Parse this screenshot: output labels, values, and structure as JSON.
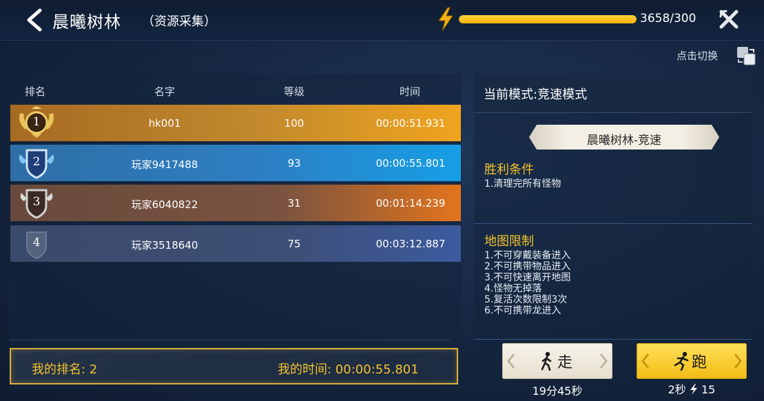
{
  "header": {
    "title": "晨曦树林",
    "subtitle": "（资源采集）",
    "energy_value": 3658,
    "energy_max": 300,
    "energy_text": "3658/300",
    "energy_fill_fraction": 1.0
  },
  "switch_label": "点击切换",
  "ranking": {
    "columns": [
      "排名",
      "名字",
      "等级",
      "时间"
    ],
    "rows": [
      {
        "rank": "1",
        "name": "hk001",
        "level": "100",
        "time": "00:00:51.931"
      },
      {
        "rank": "2",
        "name": "玩家9417488",
        "level": "93",
        "time": "00:00:55.801"
      },
      {
        "rank": "3",
        "name": "玩家6040822",
        "level": "31",
        "time": "00:01:14.239"
      },
      {
        "rank": "4",
        "name": "玩家3518640",
        "level": "75",
        "time": "00:03:12.887"
      }
    ],
    "my_rank": "我的排名: 2",
    "my_time": "我的时间: 00:00:55.801"
  },
  "mode": {
    "current_mode": "当前模式:竞速模式",
    "map_name": "晨曦树林-竞速",
    "victory_title": "胜利条件",
    "victory_lines": [
      "1.清理完所有怪物"
    ],
    "restriction_title": "地图限制",
    "restriction_lines": [
      "1.不可穿戴装备进入",
      "2.不可携带物品进入",
      "3.不可快速离开地图",
      "4.怪物无掉落",
      "5.复活次数限制3次",
      "6.不可携带龙进入"
    ]
  },
  "actions": {
    "walk_label": "走",
    "walk_time": "19分45秒",
    "run_label": "跑",
    "run_time": "2秒",
    "run_cost": "15"
  },
  "colors": {
    "gold": "#f2c12e",
    "rank1": "#c2892d",
    "rank2": "#2d7ec2",
    "rank3": "#7a5340",
    "rank4": "#3d4f75"
  }
}
